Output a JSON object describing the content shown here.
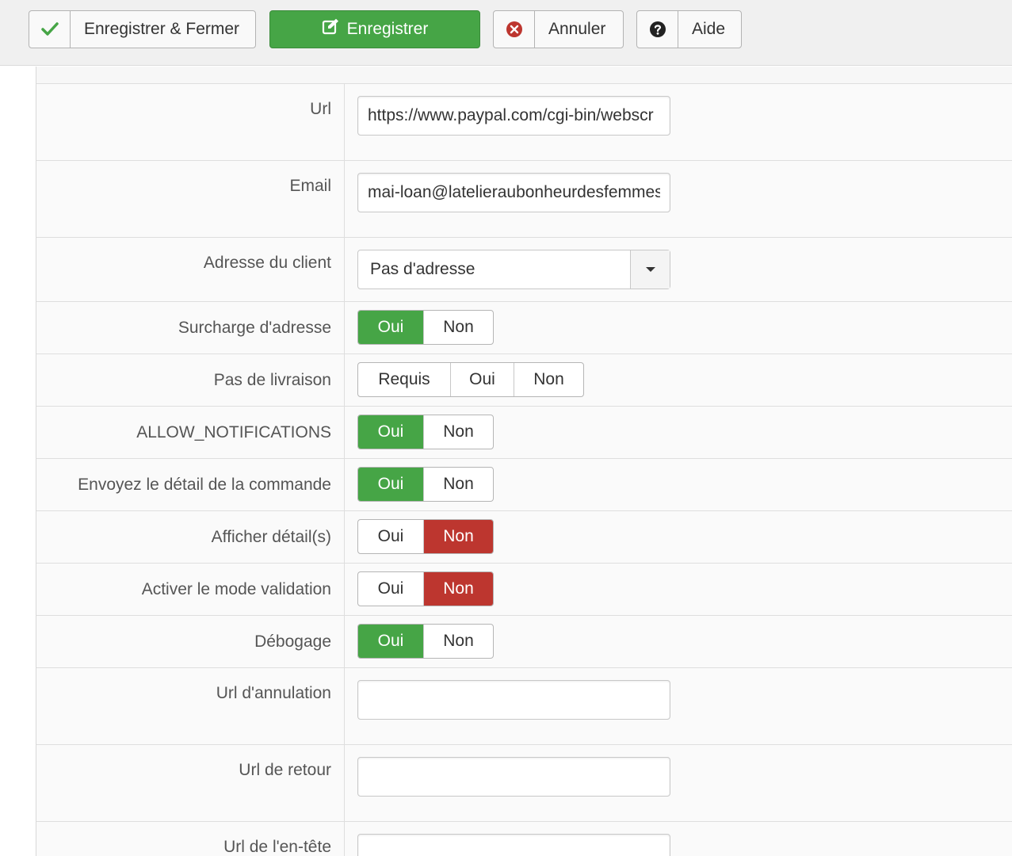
{
  "toolbar": {
    "save_close": "Enregistrer & Fermer",
    "save": "Enregistrer",
    "cancel": "Annuler",
    "help": "Aide"
  },
  "fields": {
    "url": {
      "label": "Url",
      "value": "https://www.paypal.com/cgi-bin/webscr"
    },
    "email": {
      "label": "Email",
      "value": "mai-loan@latelieraubonheurdesfemmes.com"
    },
    "client_address": {
      "label": "Adresse du client",
      "selected": "Pas d'adresse"
    },
    "address_override": {
      "label": "Surcharge d'adresse",
      "options": [
        "Oui",
        "Non"
      ],
      "active": "Oui"
    },
    "no_shipping": {
      "label": "Pas de livraison",
      "options": [
        "Requis",
        "Oui",
        "Non"
      ],
      "active": ""
    },
    "allow_notifications": {
      "label": "ALLOW_NOTIFICATIONS",
      "options": [
        "Oui",
        "Non"
      ],
      "active": "Oui"
    },
    "send_order_details": {
      "label": "Envoyez le détail de la commande",
      "options": [
        "Oui",
        "Non"
      ],
      "active": "Oui"
    },
    "show_details": {
      "label": "Afficher détail(s)",
      "options": [
        "Oui",
        "Non"
      ],
      "active": "Non"
    },
    "validation_mode": {
      "label": "Activer le mode validation",
      "options": [
        "Oui",
        "Non"
      ],
      "active": "Non"
    },
    "debug": {
      "label": "Débogage",
      "options": [
        "Oui",
        "Non"
      ],
      "active": "Oui"
    },
    "cancel_url": {
      "label": "Url d'annulation",
      "value": ""
    },
    "return_url": {
      "label": "Url de retour",
      "value": ""
    },
    "header_url": {
      "label": "Url de l'en-tête",
      "value": ""
    }
  },
  "colors": {
    "success": "#46a546",
    "danger": "#bd362f",
    "cancel_icon": "#bd362f"
  },
  "icons": {
    "save_close": "check-icon",
    "save": "edit-icon",
    "cancel": "close-circle-icon",
    "help": "question-circle-icon"
  }
}
